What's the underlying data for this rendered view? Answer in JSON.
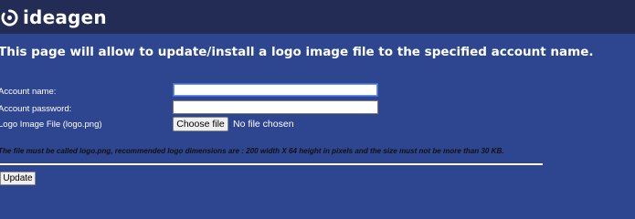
{
  "header": {
    "brand": "ideagen",
    "logo_icon": "ideagen-logo-icon"
  },
  "page": {
    "heading": "This page will allow to update/install a logo image file to the specified account name."
  },
  "form": {
    "account_name_label": "Account name:",
    "account_name_value": "",
    "account_password_label": "Account password:",
    "account_password_value": "",
    "logo_file_label": "Logo Image File (logo.png)",
    "choose_file_label": "Choose file",
    "file_status": "No file chosen",
    "note": "The file must be called logo.png, recommended logo dimensions are : 200 width X 64 height in pixels and the size must not be more than 30 KB.",
    "update_label": "Update"
  },
  "colors": {
    "page_background": "#2e4590",
    "header_background": "#222c55"
  }
}
